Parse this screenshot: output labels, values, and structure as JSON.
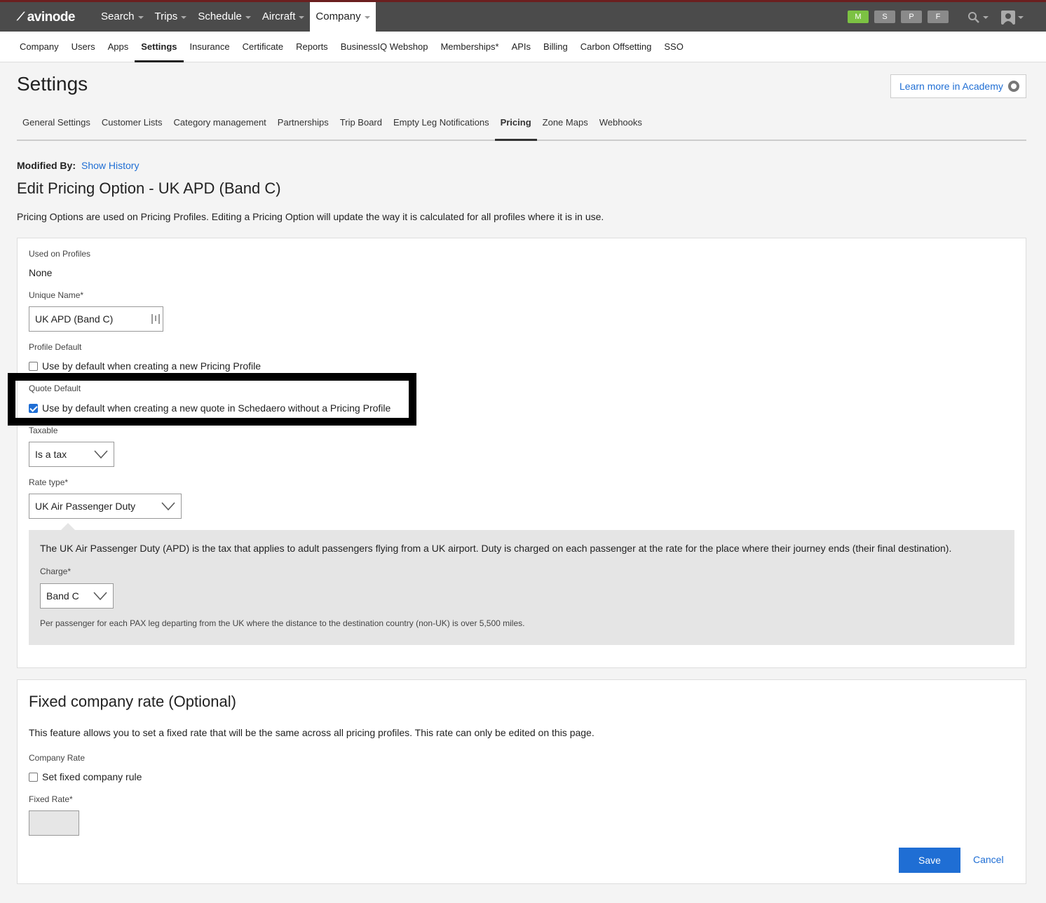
{
  "app": {
    "logo": "avinode",
    "top_nav": [
      {
        "label": "Search"
      },
      {
        "label": "Trips"
      },
      {
        "label": "Schedule"
      },
      {
        "label": "Aircraft"
      },
      {
        "label": "Company",
        "active": true
      }
    ],
    "badges": [
      {
        "label": "M",
        "color": "#7cc243"
      },
      {
        "label": "S",
        "color": "#8a8a8a"
      },
      {
        "label": "P",
        "color": "#8a8a8a"
      },
      {
        "label": "F",
        "color": "#8a8a8a"
      }
    ],
    "icons": [
      "search-icon",
      "user-icon"
    ]
  },
  "company_nav": [
    "Company",
    "Users",
    "Apps",
    "Settings",
    "Insurance",
    "Certificate",
    "Reports",
    "BusinessIQ Webshop",
    "Memberships*",
    "APIs",
    "Billing",
    "Carbon Offsetting",
    "SSO"
  ],
  "company_nav_active": "Settings",
  "header": {
    "title": "Settings",
    "academy_button": "Learn more in Academy"
  },
  "settings_tabs": [
    "General Settings",
    "Customer Lists",
    "Category management",
    "Partnerships",
    "Trip Board",
    "Empty Leg Notifications",
    "Pricing",
    "Zone Maps",
    "Webhooks"
  ],
  "settings_tab_active": "Pricing",
  "modified": {
    "label": "Modified By:",
    "link": "Show History"
  },
  "edit": {
    "title": "Edit Pricing Option - UK APD (Band C)",
    "intro": "Pricing Options are used on Pricing Profiles. Editing a Pricing Option will update the way it is calculated for all profiles where it is in use."
  },
  "form": {
    "used_on_profiles_label": "Used on Profiles",
    "used_on_profiles_value": "None",
    "unique_name_label": "Unique Name*",
    "unique_name_value": "UK APD (Band C)",
    "profile_default_label": "Profile Default",
    "profile_default_checkbox": "Use by default when creating a new Pricing Profile",
    "profile_default_checked": false,
    "quote_default_label": "Quote Default",
    "quote_default_checkbox": "Use by default when creating a new quote in Schedaero without a Pricing Profile",
    "quote_default_checked": true,
    "taxable_label": "Taxable",
    "taxable_value": "Is a tax",
    "rate_type_label": "Rate type*",
    "rate_type_value": "UK Air Passenger Duty",
    "apd_description": "The UK Air Passenger Duty (APD) is the tax that applies to adult passengers flying from a UK airport. Duty is charged on each passenger at the rate for the place where their journey ends (their final destination).",
    "charge_label": "Charge*",
    "charge_value": "Band C",
    "charge_note": "Per passenger for each PAX leg departing from the UK where the distance to the destination country (non-UK) is over 5,500 miles."
  },
  "fixed_rate": {
    "title": "Fixed company rate (Optional)",
    "description": "This feature allows you to set a fixed rate that will be the same across all pricing profiles. This rate can only be edited on this page.",
    "company_rate_label": "Company Rate",
    "company_rate_checkbox": "Set fixed company rule",
    "company_rate_checked": false,
    "fixed_rate_label": "Fixed Rate*",
    "fixed_rate_value": ""
  },
  "actions": {
    "save": "Save",
    "cancel": "Cancel"
  },
  "colors": {
    "accent": "#1f6ed4",
    "topbar": "#4b4b4b",
    "badge_active": "#7cc243"
  }
}
